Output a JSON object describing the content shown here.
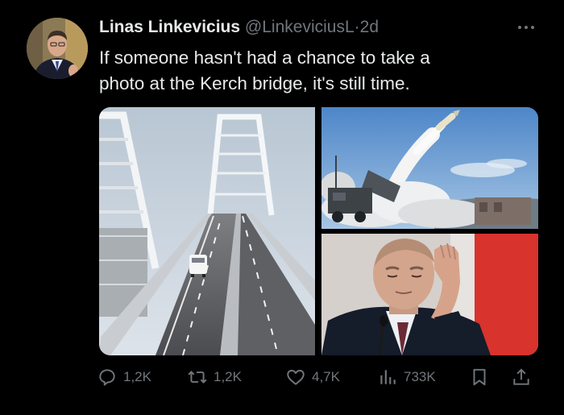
{
  "tweet": {
    "author_name": "Linas Linkevicius",
    "handle": "@LinkeviciusL",
    "separator": "·",
    "time": "2d",
    "text_lines": [
      "If someone hasn't had a chance to take a",
      "photo at the Kerch bridge, it's still time."
    ],
    "media": [
      {
        "subject": "Kerch bridge road with a white van"
      },
      {
        "subject": "rocket launching from a launcher vehicle"
      },
      {
        "subject": "man in suit holding his head"
      }
    ],
    "actions": {
      "replies": "1,2K",
      "reposts": "1,2K",
      "likes": "4,7K",
      "views": "733K"
    },
    "icons": [
      "more-icon",
      "reply-icon",
      "repost-icon",
      "like-icon",
      "views-icon",
      "bookmark-icon",
      "share-icon"
    ],
    "colors": {
      "background": "#000000",
      "text": "#e7e9ea",
      "secondary": "#71767b"
    }
  }
}
